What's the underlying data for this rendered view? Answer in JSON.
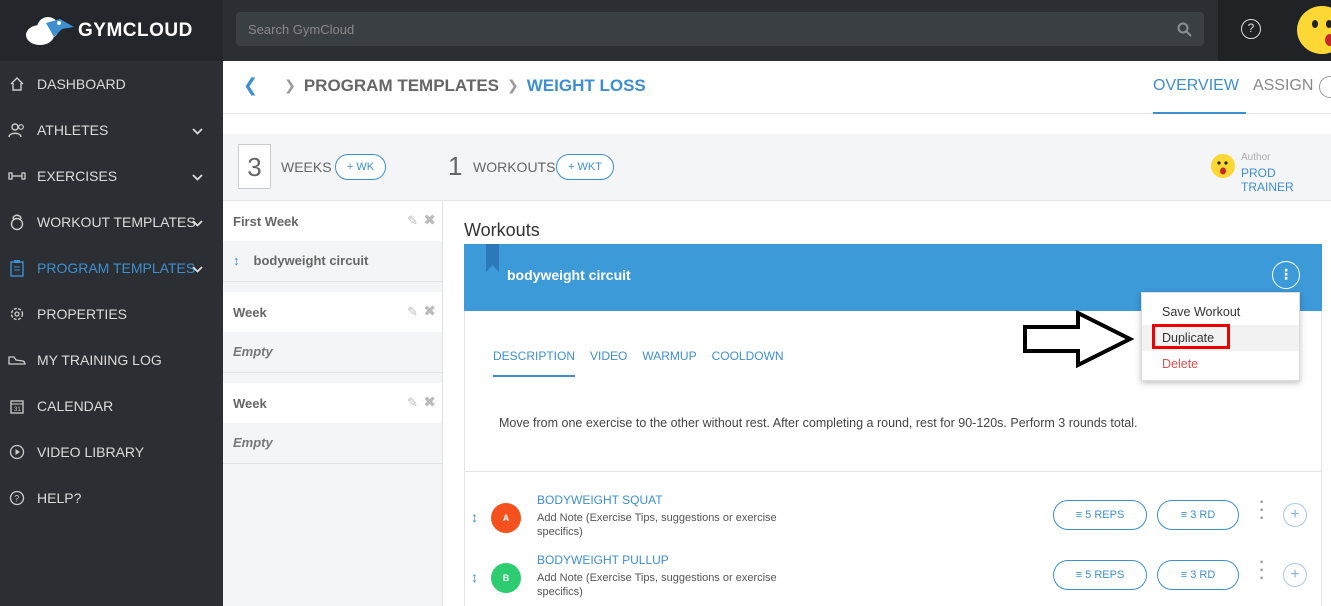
{
  "app": {
    "name": "GYMCLOUD"
  },
  "search": {
    "placeholder": "Search GymCloud"
  },
  "topbar": {
    "help_icon": "?"
  },
  "sidebar": {
    "items": [
      {
        "label": "DASHBOARD",
        "icon": "home-icon",
        "chevron": false,
        "active": false
      },
      {
        "label": "ATHLETES",
        "icon": "users-icon",
        "chevron": true,
        "active": false
      },
      {
        "label": "EXERCISES",
        "icon": "dumbbell-icon",
        "chevron": true,
        "active": false
      },
      {
        "label": "WORKOUT TEMPLATES",
        "icon": "kettlebell-icon",
        "chevron": true,
        "active": false
      },
      {
        "label": "PROGRAM TEMPLATES",
        "icon": "clipboard-icon",
        "chevron": true,
        "active": true
      },
      {
        "label": "PROPERTIES",
        "icon": "gear-icon",
        "chevron": false,
        "active": false
      },
      {
        "label": "MY TRAINING LOG",
        "icon": "shoe-icon",
        "chevron": false,
        "active": false
      },
      {
        "label": "CALENDAR",
        "icon": "calendar-icon",
        "chevron": false,
        "active": false
      },
      {
        "label": "VIDEO LIBRARY",
        "icon": "play-icon",
        "chevron": false,
        "active": false
      },
      {
        "label": "HELP?",
        "icon": "help-icon",
        "chevron": false,
        "active": false
      }
    ]
  },
  "breadcrumb": {
    "parent": "PROGRAM TEMPLATES",
    "current": "WEIGHT LOSS"
  },
  "tabs": {
    "overview": "OVERVIEW",
    "assign": "ASSIGN"
  },
  "stats": {
    "weeks_count": "3",
    "weeks_label": "WEEKS",
    "add_week": "+ WK",
    "workouts_count": "1",
    "workouts_label": "WORKOUTS",
    "add_workout": "+ WKT",
    "author_label": "Author",
    "author_name": "PROD TRAINER"
  },
  "weeks": [
    {
      "title": "First Week",
      "content": "bodyweight circuit",
      "empty": false
    },
    {
      "title": "Week",
      "content": "Empty",
      "empty": true
    },
    {
      "title": "Week",
      "content": "Empty",
      "empty": true
    }
  ],
  "workouts": {
    "heading": "Workouts",
    "name": "bodyweight circuit",
    "kebab": "⋮",
    "subtabs": [
      "DESCRIPTION",
      "VIDEO",
      "WARMUP",
      "COOLDOWN"
    ],
    "description": "Move from one exercise to the other without rest. After completing a round, rest for 90-120s. Perform 3 rounds total."
  },
  "exercises": [
    {
      "badge": "A",
      "badge_color": "#f4511e",
      "name": "BODYWEIGHT SQUAT",
      "note": "Add Note (Exercise Tips, suggestions or exercise specifics)",
      "reps": "5 REPS",
      "rounds": "3 RD"
    },
    {
      "badge": "B",
      "badge_color": "#2ecc71",
      "name": "BODYWEIGHT PULLUP",
      "note": "Add Note (Exercise Tips, suggestions or exercise specifics)",
      "reps": "5 REPS",
      "rounds": "3 RD"
    }
  ],
  "dropdown": {
    "items": [
      "Save Workout",
      "Duplicate",
      "Delete"
    ]
  },
  "colors": {
    "accent": "#3d8fd0",
    "header_blue": "#3d9ad8",
    "danger": "#d9534f",
    "sidebar_bg": "#2b2f33"
  }
}
